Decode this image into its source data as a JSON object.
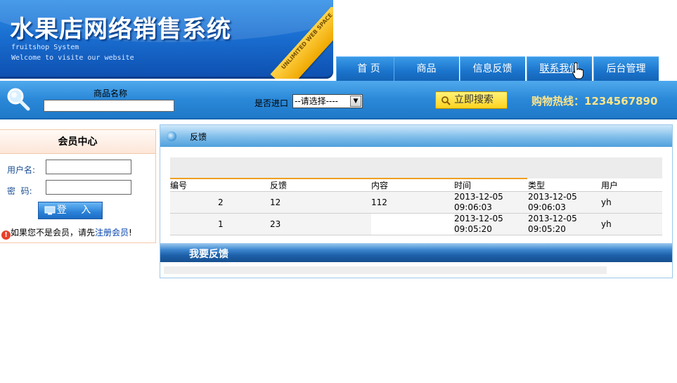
{
  "header": {
    "title": "水果店网络销售系统",
    "subtitle_1": "fruitshop System",
    "subtitle_2": "Welcome to visite our website",
    "ribbon_text": "UNLIMITED WEB SPACE"
  },
  "nav": {
    "items": [
      {
        "label": "首 页"
      },
      {
        "label": "商品"
      },
      {
        "label": "信息反馈"
      },
      {
        "label": "联系我们"
      },
      {
        "label": "后台管理"
      }
    ]
  },
  "search": {
    "name_label": "商品名称",
    "name_value": "",
    "import_label": "是否进口",
    "import_selected": "--请选择----",
    "button_label": "立即搜索",
    "hotline_label": "购物热线：",
    "hotline_number": "1234567890"
  },
  "member": {
    "title": "会员中心",
    "username_label": "用户名:",
    "username_value": "",
    "password_label": "密  码:",
    "password_value": "",
    "login_label": "登 入",
    "note_prefix": "如果您不是会员，请先",
    "note_link": "注册会员",
    "note_suffix": "!"
  },
  "feedback": {
    "panel_title": "反馈",
    "columns": [
      "编号",
      "反馈",
      "内容",
      "时间",
      "类型",
      "用户"
    ],
    "rows": [
      {
        "id": "2",
        "feedback": "12",
        "content": "112",
        "time_date": "2013-12-05",
        "time_clock": "09:06:03",
        "type_date": "2013-12-05",
        "type_clock": "09:06:03",
        "user": "yh"
      },
      {
        "id": "1",
        "feedback": "23",
        "content": "",
        "time_date": "2013-12-05",
        "time_clock": "09:05:20",
        "type_date": "2013-12-05",
        "type_clock": "09:05:20",
        "user": "yh"
      }
    ],
    "submit_section_title": "我要反馈"
  },
  "colors": {
    "nav_blue": "#1b74cc",
    "hotline_yellow": "#ffe58a",
    "table_accent": "#f0a020",
    "link_blue": "#0645ad"
  }
}
